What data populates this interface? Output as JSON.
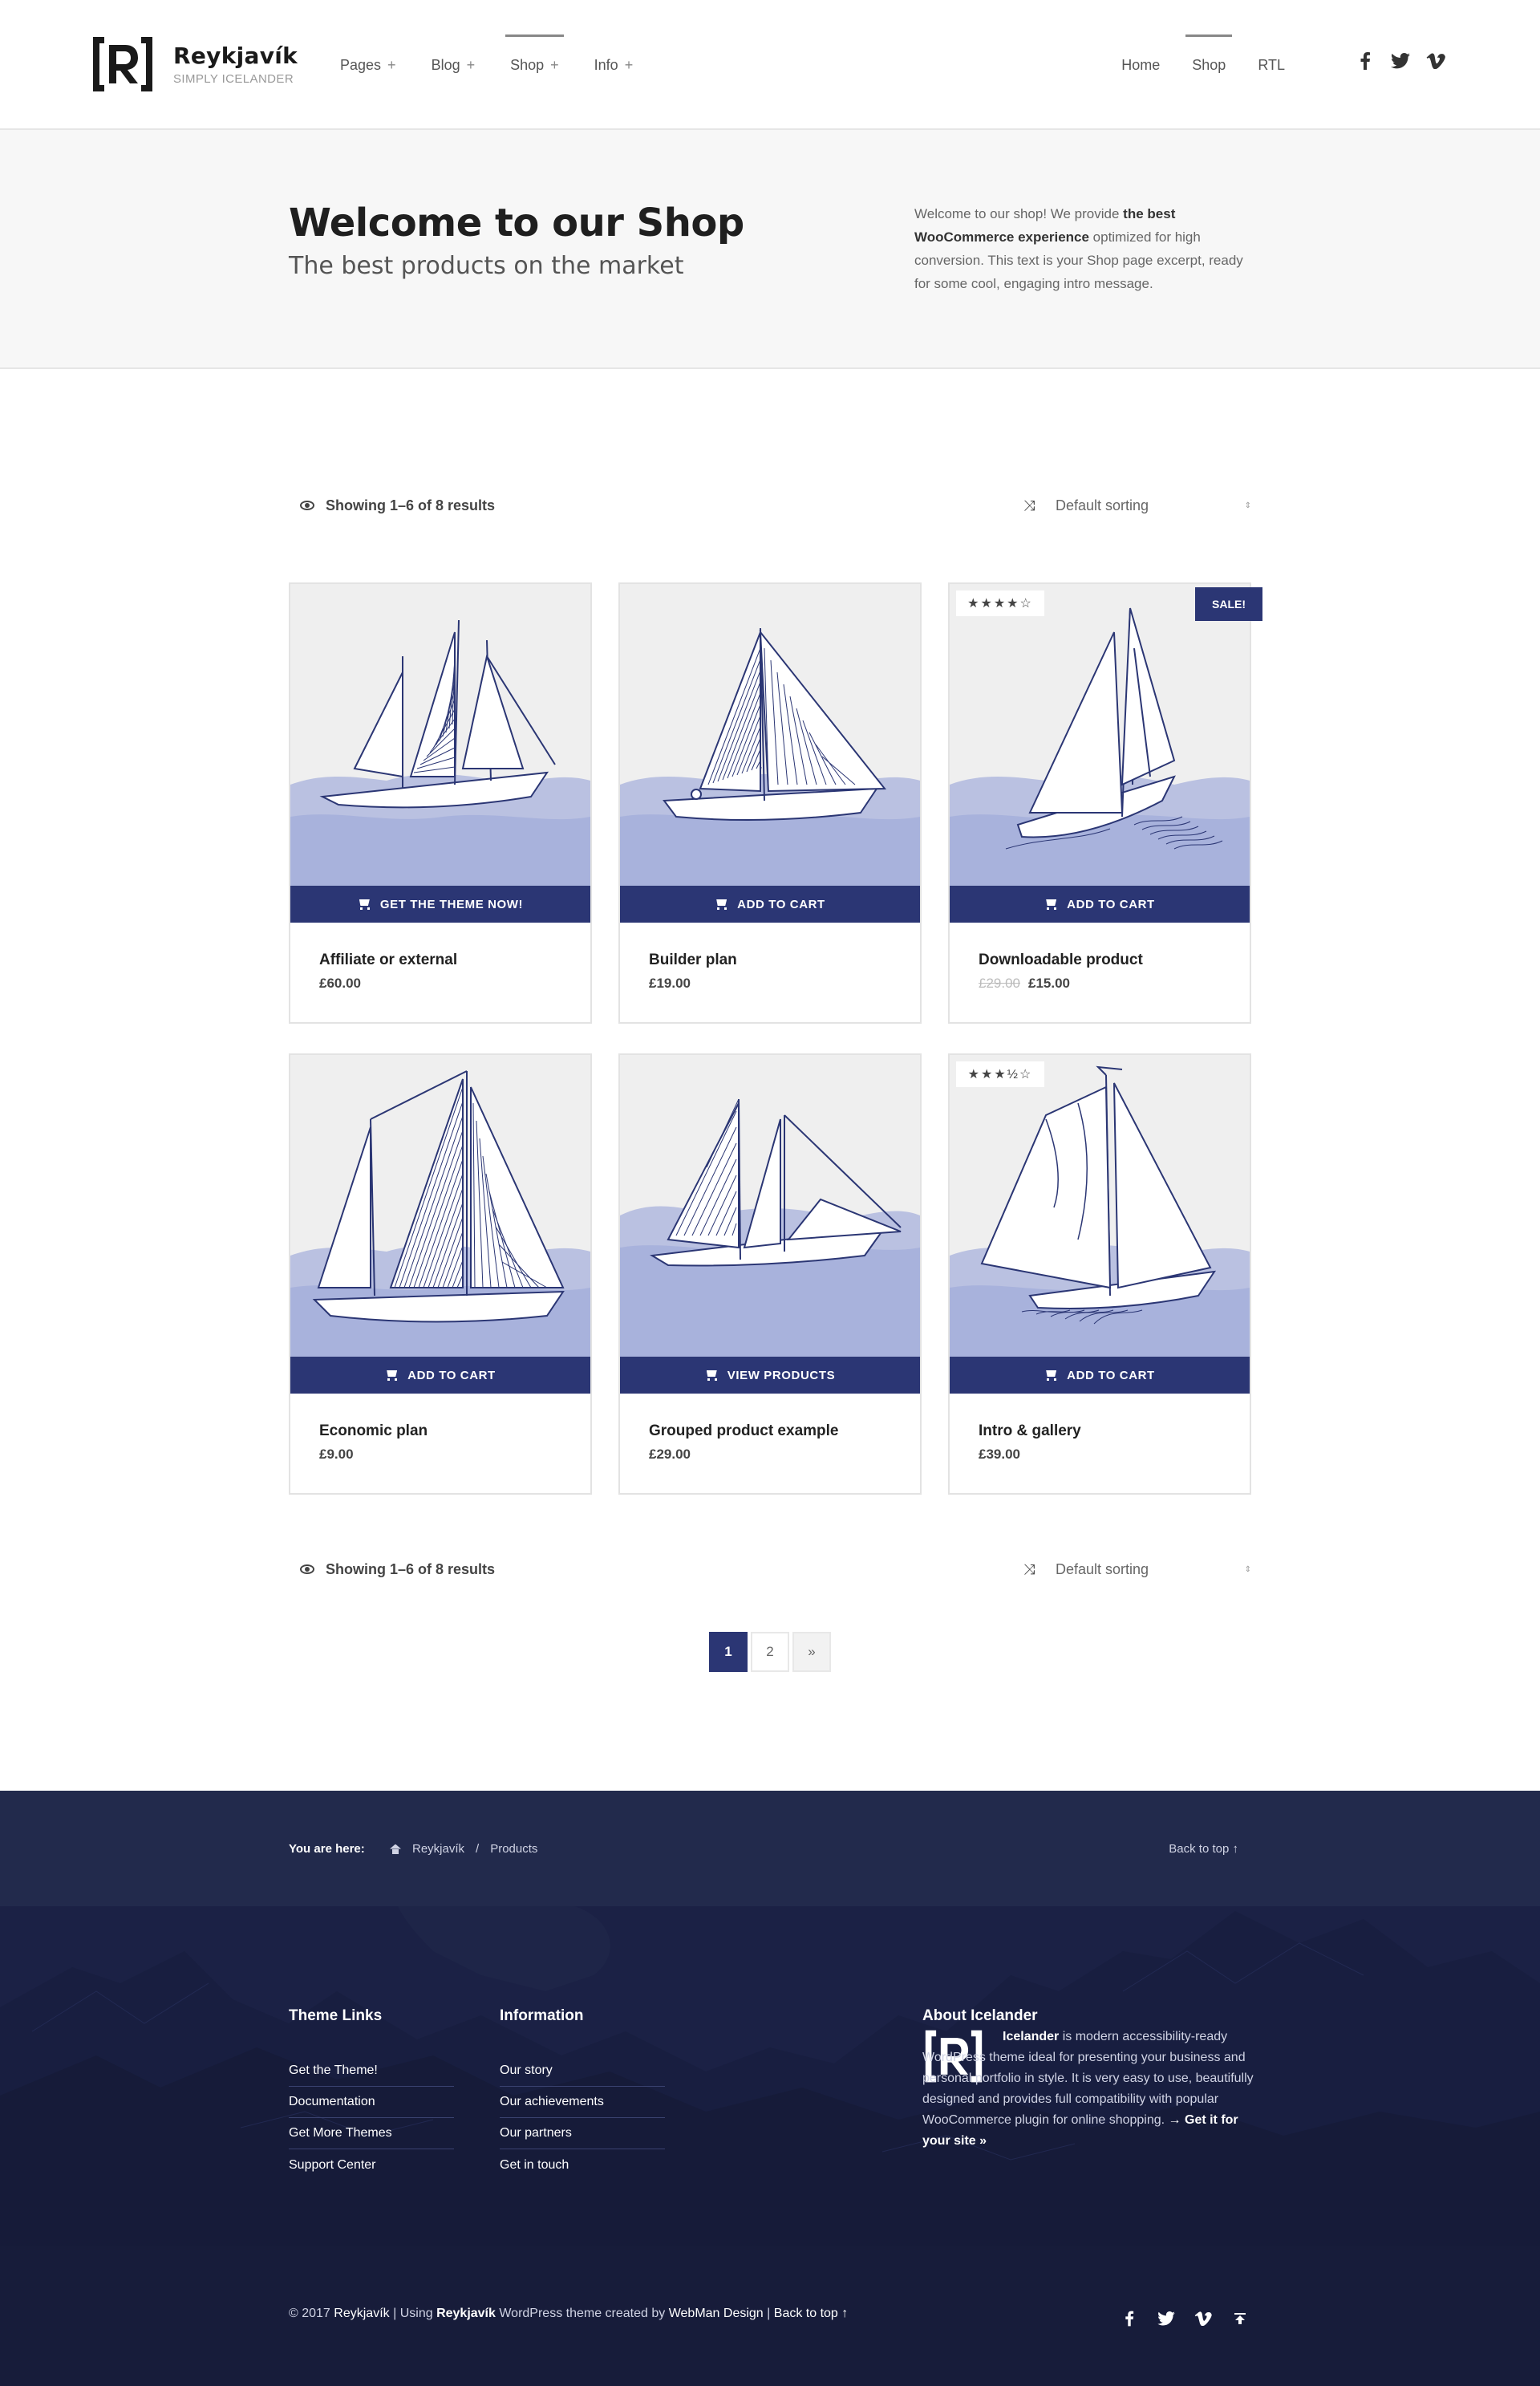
{
  "site": {
    "title": "Reykjavík",
    "tagline": "SIMPLY ICELANDER",
    "logo_glyph": "[R]"
  },
  "nav_primary": [
    {
      "label": "Pages",
      "expander": "+"
    },
    {
      "label": "Blog",
      "expander": "+"
    },
    {
      "label": "Shop",
      "expander": "+",
      "active": true
    },
    {
      "label": "Info",
      "expander": "+"
    }
  ],
  "nav_secondary": [
    {
      "label": "Home"
    },
    {
      "label": "Shop",
      "active": true
    },
    {
      "label": "RTL"
    }
  ],
  "social": [
    {
      "name": "facebook-icon",
      "glyph": "f"
    },
    {
      "name": "twitter-icon",
      "glyph": "🐦"
    },
    {
      "name": "vimeo-icon",
      "glyph": "v"
    }
  ],
  "intro": {
    "title": "Welcome to our Shop",
    "subtitle": "The best products on the market",
    "excerpt_pre": "Welcome to our shop! We provide ",
    "excerpt_bold": "the best WooCommerce experience",
    "excerpt_post": " optimized for high conversion. This text is your Shop page excerpt, ready for some cool, engaging intro message."
  },
  "results": {
    "count_text": "Showing 1–6 of 8 results",
    "sort_label": "Default sorting",
    "sort_arrow": "⇕"
  },
  "products": [
    {
      "name": "Affiliate or external",
      "price": "£60.00",
      "button": "GET THE THEME NOW!"
    },
    {
      "name": "Builder plan",
      "price": "£19.00",
      "button": "ADD TO CART"
    },
    {
      "name": "Downloadable product",
      "old_price": "£29.00",
      "price": "£15.00",
      "button": "ADD TO CART",
      "rating_stars": "★★★★☆",
      "rating": 4,
      "sale": "SALE!"
    },
    {
      "name": "Economic plan",
      "price": "£9.00",
      "button": "ADD TO CART"
    },
    {
      "name": "Grouped product example",
      "price": "£29.00",
      "button": "VIEW PRODUCTS"
    },
    {
      "name": "Intro & gallery",
      "price": "£39.00",
      "button": "ADD TO CART",
      "rating_stars": "★★★½☆",
      "rating": 3.5
    }
  ],
  "pagination": {
    "pages": [
      "1",
      "2"
    ],
    "next": "»",
    "current": "1"
  },
  "footer": {
    "you_are_here": "You are here:",
    "crumbs": [
      "Reykjavík",
      "/",
      "Products"
    ],
    "back_to_top": "Back to top ↑",
    "theme_links": {
      "title": "Theme Links",
      "items": [
        "Get the Theme!",
        "Documentation",
        "Get More Themes",
        "Support Center"
      ]
    },
    "information": {
      "title": "Information",
      "items": [
        "Our story",
        "Our achievements",
        "Our partners",
        "Get in touch"
      ]
    },
    "about": {
      "title": "About Icelander",
      "bold": "Icelander",
      "text": " is modern accessibility-ready WordPress theme ideal for presenting your business and personal portfolio in style. It is very easy to use, beautifully designed and provides full compatibility with popular WooCommerce plugin for online shopping. ",
      "link": "→ Get it for your site »"
    },
    "copyright": {
      "year": "© 2017",
      "site": "Reykjavík",
      "sep1": "|",
      "using": "Using",
      "theme": "Reykjavík",
      "wp": "WordPress theme created by",
      "author": "WebMan Design",
      "sep2": "|",
      "top": "Back to top ↑"
    },
    "social": [
      {
        "name": "facebook-icon",
        "glyph": "f"
      },
      {
        "name": "twitter-icon",
        "glyph": "t"
      },
      {
        "name": "vimeo-icon",
        "glyph": "v"
      },
      {
        "name": "back-to-top-icon",
        "glyph": "⇞"
      }
    ]
  },
  "colors": {
    "accent": "#2b3674",
    "intro_bg": "#f7f7f7",
    "footer_bg": "#1b2145",
    "wave": "#a8b2dc"
  }
}
